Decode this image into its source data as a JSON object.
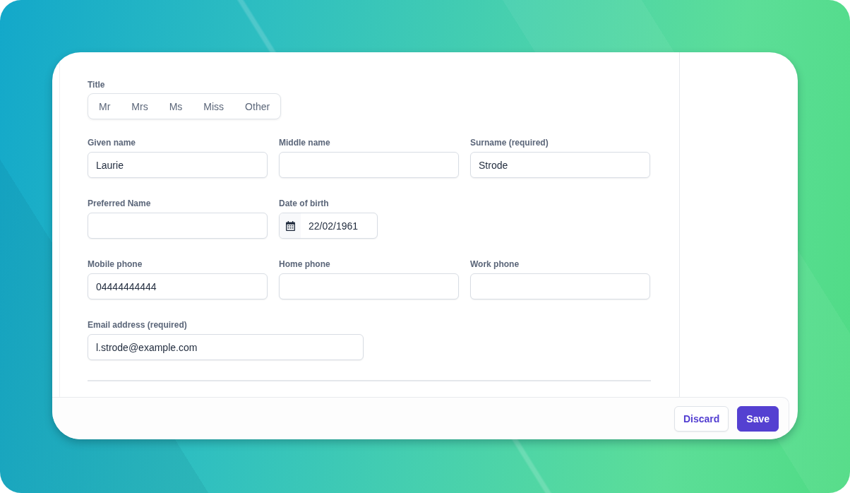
{
  "form": {
    "title": {
      "label": "Title",
      "options": [
        {
          "label": "Mr",
          "selected": false
        },
        {
          "label": "Mrs",
          "selected": false
        },
        {
          "label": "Ms",
          "selected": false
        },
        {
          "label": "Miss",
          "selected": false
        },
        {
          "label": "Other",
          "selected": false
        }
      ]
    },
    "rows": [
      {
        "fields": [
          {
            "kind": "text",
            "label": "Given name",
            "value": "Laurie"
          },
          {
            "kind": "text",
            "label": "Middle name"
          },
          {
            "kind": "text",
            "label": "Surname (required)",
            "value": "Strode"
          }
        ]
      },
      {
        "fields": [
          {
            "kind": "text",
            "label": "Preferred Name"
          },
          {
            "kind": "date",
            "label": "Date of birth",
            "value": "22/02/1961"
          }
        ]
      },
      {
        "fields": [
          {
            "kind": "text",
            "label": "Mobile phone",
            "value": "04444444444"
          },
          {
            "kind": "text",
            "label": "Home phone"
          },
          {
            "kind": "text",
            "label": "Work phone"
          }
        ]
      },
      {
        "fields": [
          {
            "kind": "text",
            "label": "Email address (required)",
            "value": "l.strode@example.com"
          }
        ]
      }
    ]
  },
  "footer": {
    "buttons": [
      {
        "kind": "secondary",
        "label": "Discard"
      },
      {
        "kind": "primary",
        "label": "Save"
      }
    ]
  }
}
